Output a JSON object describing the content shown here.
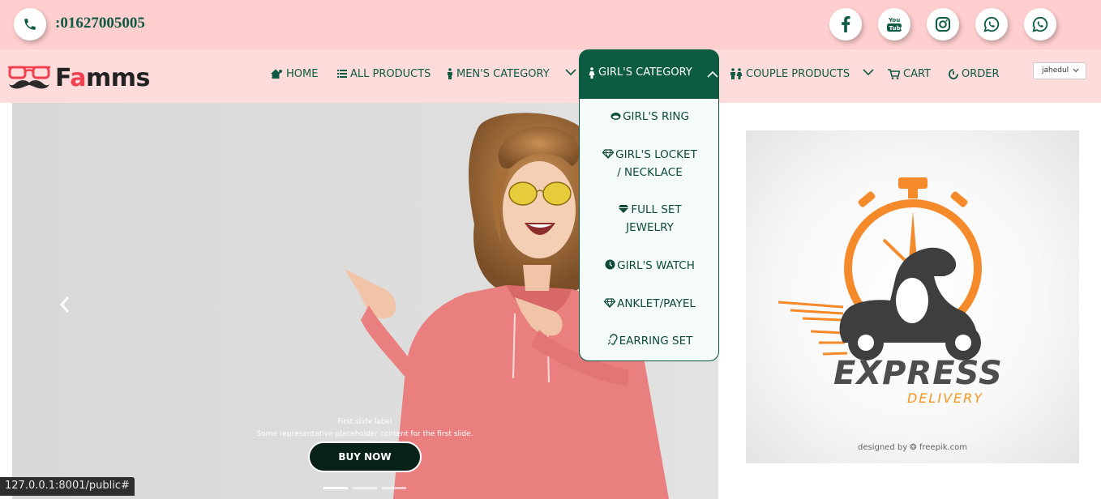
{
  "topbar": {
    "phone": ":01627005005",
    "social": [
      {
        "icon": "facebook-icon"
      },
      {
        "icon": "youtube-icon",
        "text": "You Tube"
      },
      {
        "icon": "instagram-icon"
      },
      {
        "icon": "whatsapp-icon"
      },
      {
        "icon": "whatsapp-icon"
      }
    ]
  },
  "brand": {
    "logo_prefix": "F",
    "logo_accent": "a",
    "logo_suffix": "mms",
    "accent_color": "#ef4150"
  },
  "nav": {
    "home": "HOME",
    "all_products": "ALL PRODUCTS",
    "mens_category": "MEN'S CATEGORY",
    "girls_category": "GIRL'S CATEGORY",
    "couple_products": "COUPLE PRODUCTS",
    "cart": "CART",
    "order": "ORDER",
    "user": "jahedul"
  },
  "dropdown": {
    "items": [
      {
        "label": "GIRL'S RING",
        "icon": "ring-icon"
      },
      {
        "label_line1": "GIRL'S LOCKET",
        "label_line2": "/ NECKLACE",
        "icon": "gem-icon"
      },
      {
        "label_line1": "FULL SET",
        "label_line2": "JEWELRY",
        "icon": "gem-icon"
      },
      {
        "label": "GIRL'S WATCH",
        "icon": "clock-icon"
      },
      {
        "label": "ANKLET/PAYEL",
        "icon": "gem-icon"
      },
      {
        "label": "EARRING SET",
        "icon": "ear-icon"
      }
    ]
  },
  "hero": {
    "caption_title": "First slide label",
    "caption_text": "Some representative placeholder content for the first slide.",
    "button": "BUY NOW",
    "slides": 3,
    "active_slide": 1
  },
  "delivery": {
    "title": "EXPRESS",
    "subtitle": "DELIVERY",
    "credit": "designed by ❂ freepik.com"
  },
  "status": {
    "url": "127.0.0.1:8001/public#"
  },
  "colors": {
    "primary_green": "#0b5c41",
    "topbar_pink": "#ffcfcf",
    "nav_pink": "#ffdcdc",
    "orange": "#f7941d"
  }
}
